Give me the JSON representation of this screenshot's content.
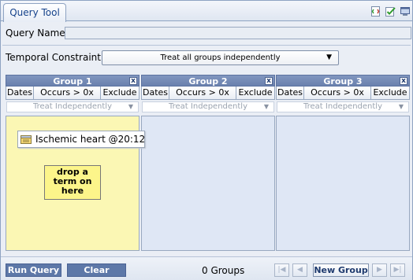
{
  "header": {
    "tab_label": "Query Tool",
    "icons": [
      "export-xml-icon",
      "check-icon",
      "window-icon"
    ]
  },
  "query": {
    "name_label": "Query Name:",
    "name_value": ""
  },
  "temporal": {
    "label": "Temporal Constraint:",
    "value": "Treat all groups independently"
  },
  "groups": [
    {
      "title": "Group 1",
      "buttons": [
        "Dates",
        "Occurs > 0x",
        "Exclude"
      ],
      "timing": "Treat Independently",
      "term": "Ischemic heart @20:12...",
      "drop_hint": "drop a term on here"
    },
    {
      "title": "Group 2",
      "buttons": [
        "Dates",
        "Occurs > 0x",
        "Exclude"
      ],
      "timing": "Treat Independently"
    },
    {
      "title": "Group 3",
      "buttons": [
        "Dates",
        "Occurs > 0x",
        "Exclude"
      ],
      "timing": "Treat Independently"
    }
  ],
  "footer": {
    "run_query": "Run Query",
    "clear": "Clear",
    "group_count": "0 Groups",
    "new_group": "New Group"
  },
  "colors": {
    "header_blue": "#6a81ae",
    "active_panel": "#fbf7b4",
    "inactive_panel": "#dfe7f5",
    "button_blue": "#5d78a8"
  }
}
